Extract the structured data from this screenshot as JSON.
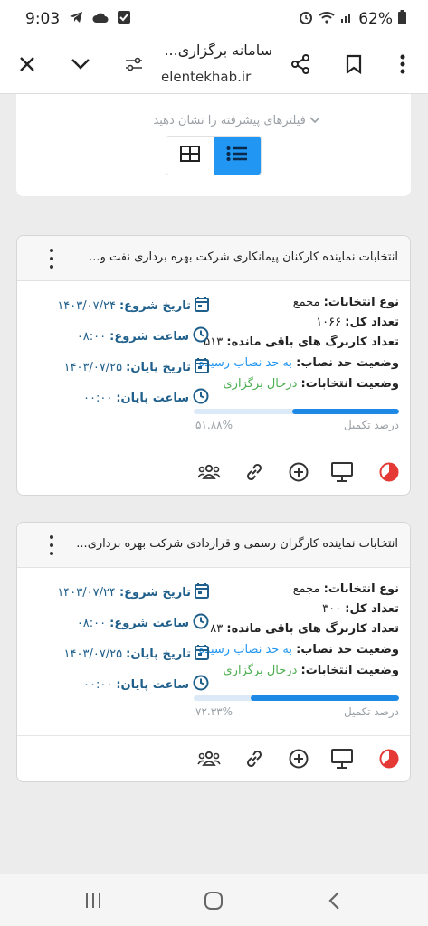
{
  "status": {
    "time": "9:03",
    "battery": "62%"
  },
  "browser": {
    "title": "سامانه برگزاری...",
    "url": "elentekhab.ir"
  },
  "filters": {
    "toggle_text": "فیلترهای پیشرفته را نشان دهید"
  },
  "cards": [
    {
      "title": "انتخابات نماینده کارکنان پیمانکاری شرکت بهره برداری نفت و...",
      "type_label": "نوع انتخابات:",
      "type_value": "مجمع",
      "total_label": "تعداد کل:",
      "total_value": "۱۰۶۶",
      "remaining_label": "تعداد کاربرگ های باقی مانده:",
      "remaining_value": "۵۱۳",
      "quorum_label": "وضعیت حد نصاب:",
      "quorum_value": "به حد نصاب رسیده",
      "status_label": "وضعیت انتخابات:",
      "status_value": "درحال برگزاری",
      "start_date_label": "تاریخ شروع:",
      "start_date": "۱۴۰۳/۰۷/۲۴",
      "start_time_label": "ساعت شروع:",
      "start_time": "۰۸:۰۰",
      "end_date_label": "تاریخ پایان:",
      "end_date": "۱۴۰۳/۰۷/۲۵",
      "end_time_label": "ساعت پایان:",
      "end_time": "۰۰:۰۰",
      "progress_label": "درصد تکمیل",
      "progress_text": "۵۱.۸۸%",
      "progress_value": 51.88
    },
    {
      "title": "انتخابات نماینده کارگران رسمی و قراردادی شرکت بهره برداری...",
      "type_label": "نوع انتخابات:",
      "type_value": "مجمع",
      "total_label": "تعداد کل:",
      "total_value": "۳۰۰",
      "remaining_label": "تعداد کاربرگ های باقی مانده:",
      "remaining_value": "۸۳",
      "quorum_label": "وضعیت حد نصاب:",
      "quorum_value": "به حد نصاب رسیده",
      "status_label": "وضعیت انتخابات:",
      "status_value": "درحال برگزاری",
      "start_date_label": "تاریخ شروع:",
      "start_date": "۱۴۰۳/۰۷/۲۴",
      "start_time_label": "ساعت شروع:",
      "start_time": "۰۸:۰۰",
      "end_date_label": "تاریخ پایان:",
      "end_date": "۱۴۰۳/۰۷/۲۵",
      "end_time_label": "ساعت پایان:",
      "end_time": "۰۰:۰۰",
      "progress_label": "درصد تکمیل",
      "progress_text": "۷۲.۳۳%",
      "progress_value": 72.33
    }
  ],
  "colors": {
    "accent": "#2196f3",
    "success": "#4caf50",
    "danger": "#e53935",
    "date_text": "#1f5f8b"
  },
  "icons": [
    "close-icon",
    "chevron-down-icon",
    "tune-icon",
    "share-icon",
    "bookmark-icon",
    "more-vert-icon",
    "grid-icon",
    "list-icon",
    "calendar-icon",
    "clock-icon",
    "group-icon",
    "link-icon",
    "add-circle-icon",
    "monitor-icon",
    "pie-chart-icon"
  ]
}
